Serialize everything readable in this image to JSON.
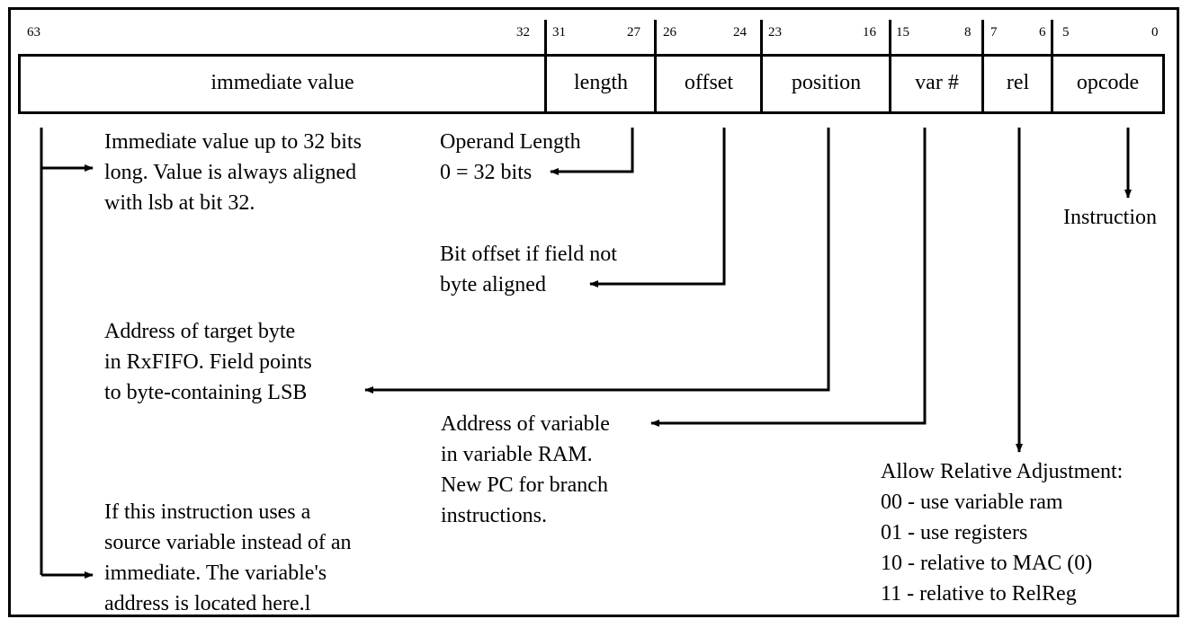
{
  "diagram": {
    "bit_numbers": {
      "b63": "63",
      "b32": "32",
      "b31": "31",
      "b27": "27",
      "b26": "26",
      "b24": "24",
      "b23": "23",
      "b16": "16",
      "b15": "15",
      "b8": "8",
      "b7": "7",
      "b6": "6",
      "b5": "5",
      "b0": "0"
    },
    "fields": {
      "immediate": "immediate value",
      "length": "length",
      "offset": "offset",
      "position": "position",
      "var": "var #",
      "rel": "rel",
      "opcode": "opcode"
    },
    "descriptions": {
      "immediate": "Immediate value up to 32 bits\nlong. Value is always aligned\nwith lsb at bit 32.",
      "length": "Operand Length\n0 = 32 bits",
      "offset": "Bit offset if field not\nbyte aligned",
      "position": "Address of target byte\nin RxFIFO. Field points\nto byte-containing LSB",
      "var": "Address of variable\nin variable RAM.\nNew PC for branch\ninstructions.",
      "source_var": "If this instruction uses a\nsource variable instead of an\nimmediate. The variable's\naddress is located here.l",
      "opcode": "Instruction",
      "rel_title": "Allow Relative Adjustment:",
      "rel_options": [
        "00 - use variable ram",
        "01 - use registers",
        "10 - relative to MAC (0)",
        "11 - relative to RelReg"
      ]
    }
  }
}
